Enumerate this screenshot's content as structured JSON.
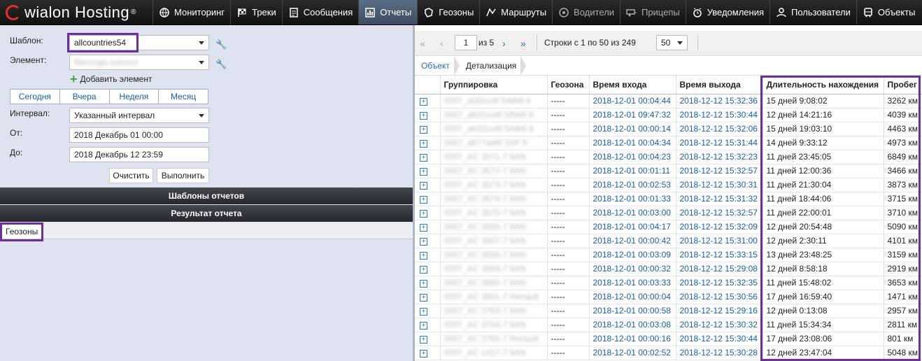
{
  "app": {
    "logo_text": "wialon Hosting"
  },
  "nav": [
    {
      "label": "Мониторинг",
      "icon": "globe-icon"
    },
    {
      "label": "Треки",
      "icon": "checkered-flag-icon"
    },
    {
      "label": "Сообщения",
      "icon": "document-icon"
    },
    {
      "label": "Отчеты",
      "icon": "report-chart-icon"
    },
    {
      "label": "Геозоны",
      "icon": "geofence-icon"
    },
    {
      "label": "Маршруты",
      "icon": "route-icon"
    },
    {
      "label": "Водители",
      "icon": "steering-wheel-icon"
    },
    {
      "label": "Прицепы",
      "icon": "trailer-icon"
    },
    {
      "label": "Уведомления",
      "icon": "alarm-clock-icon"
    },
    {
      "label": "Пользователи",
      "icon": "user-icon"
    },
    {
      "label": "Объекты",
      "icon": "bus-icon"
    }
  ],
  "form": {
    "template_label": "Шаблон:",
    "template_value": "allcountries54",
    "element_label": "Элемент:",
    "element_value": "Benzoga sanvoci",
    "add_element": "Добавить элемент",
    "quick_ranges": [
      "Сегодня",
      "Вчера",
      "Неделя",
      "Месяц"
    ],
    "interval_label": "Интервал:",
    "interval_value": "Указанный интервал",
    "from_label": "От:",
    "from_value": "2018 Декабрь 01 00:00",
    "to_label": "До:",
    "to_value": "2018 Декабрь 12 23:59",
    "clear_button": "Очистить",
    "run_button": "Выполнить"
  },
  "panels": {
    "templates_bar": "Шаблоны отчетов",
    "result_bar": "Результат отчета",
    "result_tab": "Геозоны"
  },
  "pager": {
    "page": "1",
    "of_pages": "из 5",
    "rows_info": "Строки с 1 по 50 из 249",
    "page_size": "50"
  },
  "breadcrumbs": [
    "Объект",
    "Детализация"
  ],
  "table": {
    "headers": [
      "Группировка",
      "Геозона",
      "Время входа",
      "Время выхода",
      "Длительность нахождения",
      "Пробег"
    ],
    "rows": [
      [
        "0007_a0i0so4f 5AW6 6",
        "-----",
        "2018-12-01 00:04:44",
        "2018-12-12 15:32:36",
        "15 дней 9:08:02",
        "3262 км"
      ],
      [
        "0007_a622so4f 5AW6 6",
        "-----",
        "2018-12-01 09:47:32",
        "2018-12-12 15:30:44",
        "12 дней 14:21:16",
        "4039 км"
      ],
      [
        "0007_a622so4f 5AW6 6",
        "-----",
        "2018-12-01 00:00:14",
        "2018-12-12 15:32:06",
        "15 дней 19:03:10",
        "4463 км"
      ],
      [
        "0007_a677ad4f 2HF 6",
        "-----",
        "2018-12-01 00:04:34",
        "2018-12-12 15:31:44",
        "14 дней 9:33:12",
        "4973 км"
      ],
      [
        "0007_AC 3571-7 6AN",
        "-----",
        "2018-12-01 00:04:23",
        "2018-12-12 15:32:23",
        "11 дней 23:45:05",
        "6849 км"
      ],
      [
        "0007_AC 3572-7 6AN",
        "-----",
        "2018-12-01 00:01:11",
        "2018-12-12 15:32:57",
        "11 дней 12:00:36",
        "3466 км"
      ],
      [
        "0007_AC 3573-7 6AN",
        "-----",
        "2018-12-01 00:02:53",
        "2018-12-12 15:30:31",
        "11 дней 21:30:04",
        "3873 км"
      ],
      [
        "0007_AC 3574-7 6AN",
        "-----",
        "2018-12-01 00:01:33",
        "2018-12-12 15:31:32",
        "11 дней 18:44:06",
        "3715 км"
      ],
      [
        "0007_AC 3575-7 6AN",
        "-----",
        "2018-12-01 00:03:00",
        "2018-12-12 15:32:57",
        "11 дней 22:00:01",
        "3710 км"
      ],
      [
        "0007_AC 3856-7 6AN",
        "-----",
        "2018-12-01 00:04:17",
        "2018-12-12 15:32:09",
        "12 дней 20:54:48",
        "5090 км"
      ],
      [
        "0007_AC 3857-7 6AN",
        "-----",
        "2018-12-01 00:00:42",
        "2018-12-12 15:31:00",
        "12 дней 2:30:11",
        "4101 км"
      ],
      [
        "0007_AC 3858-7 6AN",
        "-----",
        "2018-12-01 00:03:09",
        "2018-12-12 15:33:15",
        "13 дней 23:48:25",
        "3159 км"
      ],
      [
        "0007_AC 3859-7 6AN",
        "-----",
        "2018-12-01 00:00:32",
        "2018-12-12 15:29:08",
        "12 дней 8:58:18",
        "2919 км"
      ],
      [
        "0007_AC 3860-7 6AN",
        "-----",
        "2018-12-01 00:03:33",
        "2018-12-12 15:32:35",
        "11 дней 15:48:02",
        "3653 км"
      ],
      [
        "0007_AC 3861-7 Renault",
        "-----",
        "2018-12-01 00:00:04",
        "2018-12-12 15:30:56",
        "17 дней 16:59:40",
        "1471 км"
      ],
      [
        "0007_AC 3763-7 6AN",
        "-----",
        "2018-12-01 00:00:58",
        "2018-12-12 15:29:16",
        "12 дней 0:13:08",
        "2957 км"
      ],
      [
        "0007_AC 3764-7 6AN",
        "-----",
        "2018-12-01 00:03:08",
        "2018-12-12 15:30:32",
        "11 дней 15:34:34",
        "2811 км"
      ],
      [
        "0007_AC 3765-7 Renault",
        "-----",
        "2018-12-01 00:00:16",
        "2018-12-12 15:30:44",
        "17 дней 23:08:06",
        "801 км"
      ],
      [
        "0007_AC 1417-7 6AN",
        "-----",
        "2018-12-01 00:02:52",
        "2018-12-12 15:30:28",
        "12 дней 23:47:04",
        "5048 км"
      ]
    ]
  },
  "colors": {
    "highlight": "#6b2f9c",
    "link": "#1a5ea5",
    "active_tab": "#4b5f77"
  }
}
